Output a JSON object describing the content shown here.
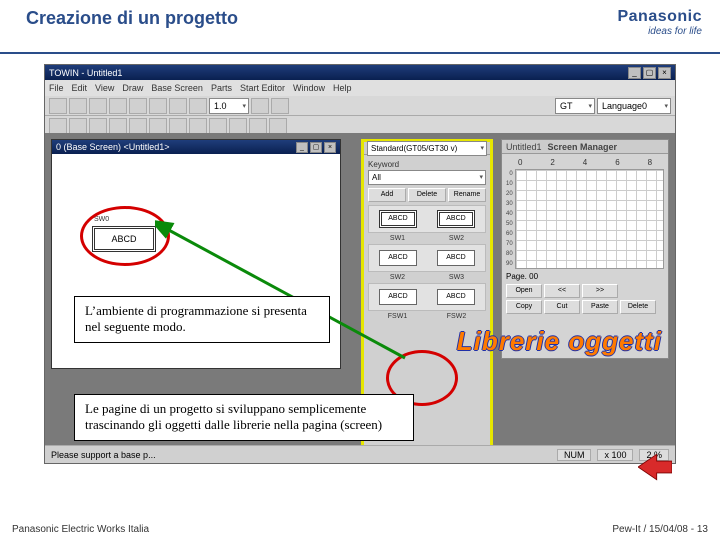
{
  "header": {
    "title": "Creazione di un progetto"
  },
  "brand": {
    "name": "Panasonic",
    "tagline": "ideas for life"
  },
  "app": {
    "title": "TOWIN - Untitled1",
    "menu": [
      "File",
      "Edit",
      "View",
      "Draw",
      "Base Screen",
      "Parts",
      "Start Editor",
      "Window",
      "Help"
    ],
    "zoom": "1.0",
    "model": "GT",
    "lang": "Language0",
    "status_left": "Please support a base p...",
    "status_num": "NUM",
    "status_zoom": "x 100",
    "status_pct": "2 %"
  },
  "base_window": {
    "title": "0 (Base Screen) <Untitled1>",
    "obj_label": "ABCD",
    "sw_tag": "SW0"
  },
  "library": {
    "tab": "Standard(GT05/GT30 v)",
    "keyword_label": "Keyword",
    "keyword_value": "All",
    "buttons": {
      "add": "Add",
      "delete": "Delete",
      "rename": "Rename"
    },
    "rows": [
      {
        "l": "ABCD",
        "r": "ABCD",
        "cap_l": "SW1",
        "cap_r": "SW2"
      },
      {
        "l": "ABCD",
        "r": "ABCD",
        "cap_l": "SW2",
        "cap_r": "SW3"
      },
      {
        "l": "ABCD",
        "r": "ABCD",
        "cap_l": "FSW1",
        "cap_r": "FSW2"
      }
    ]
  },
  "mgr": {
    "doc": "Untitled1",
    "title": "Screen Manager",
    "cols": [
      "0",
      "2",
      "4",
      "6",
      "8"
    ],
    "page_label": "Page. 00",
    "buttons": {
      "open": "Open",
      "prev": "<<",
      "next": ">>",
      "copy": "Copy",
      "cut": "Cut",
      "paste": "Paste",
      "delete": "Delete"
    }
  },
  "callouts": {
    "c1": "L’ambiente di programmazione si presenta nel seguente modo.",
    "c2": "Le pagine di un progetto si sviluppano semplicemente trascinando gli oggetti dalle librerie nella pagina (screen)"
  },
  "big_text": "Librerie oggetti",
  "footer": {
    "left": "Panasonic Electric Works Italia",
    "right": "Pew-It / 15/04/08 - 13"
  }
}
